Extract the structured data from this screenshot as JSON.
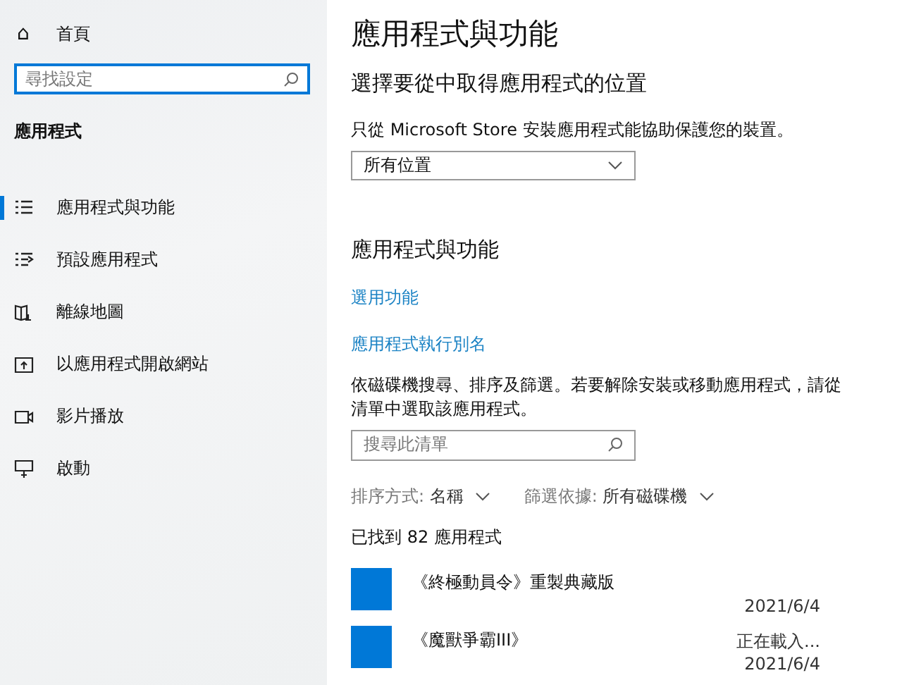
{
  "sidebar": {
    "home": {
      "icon": "⌂",
      "label": "首頁"
    },
    "search": {
      "placeholder": "尋找設定"
    },
    "heading": "應用程式",
    "items": [
      {
        "label": "應用程式與功能",
        "selected": true
      },
      {
        "label": "預設應用程式",
        "selected": false
      },
      {
        "label": "離線地圖",
        "selected": false
      },
      {
        "label": "以應用程式開啟網站",
        "selected": false
      },
      {
        "label": "影片播放",
        "selected": false
      },
      {
        "label": "啟動",
        "selected": false
      }
    ]
  },
  "main": {
    "title": "應用程式與功能",
    "source_heading": "選擇要從中取得應用程式的位置",
    "source_note": "只從 Microsoft Store 安裝應用程式能協助保護您的裝置。",
    "source_dropdown": {
      "value": "所有位置"
    },
    "apps_heading": "應用程式與功能",
    "links": [
      "選用功能",
      "應用程式執行別名"
    ],
    "apps_note": "依磁碟機搜尋、排序及篩選。若要解除安裝或移動應用程式，請從清單中選取該應用程式。",
    "list_search": {
      "placeholder": "搜尋此清單"
    },
    "sort": {
      "label": "排序方式:",
      "value": "名稱"
    },
    "filter": {
      "label": "篩選依據:",
      "value": "所有磁碟機"
    },
    "count": "已找到 82 應用程式",
    "apps": [
      {
        "name": "《終極動員令》重製典藏版",
        "date": "2021/6/4",
        "color": "#0078d7"
      },
      {
        "name": "《魔獸爭霸III》",
        "status": "正在載入...",
        "date": "2021/6/4",
        "color": "#0078d7"
      }
    ]
  }
}
